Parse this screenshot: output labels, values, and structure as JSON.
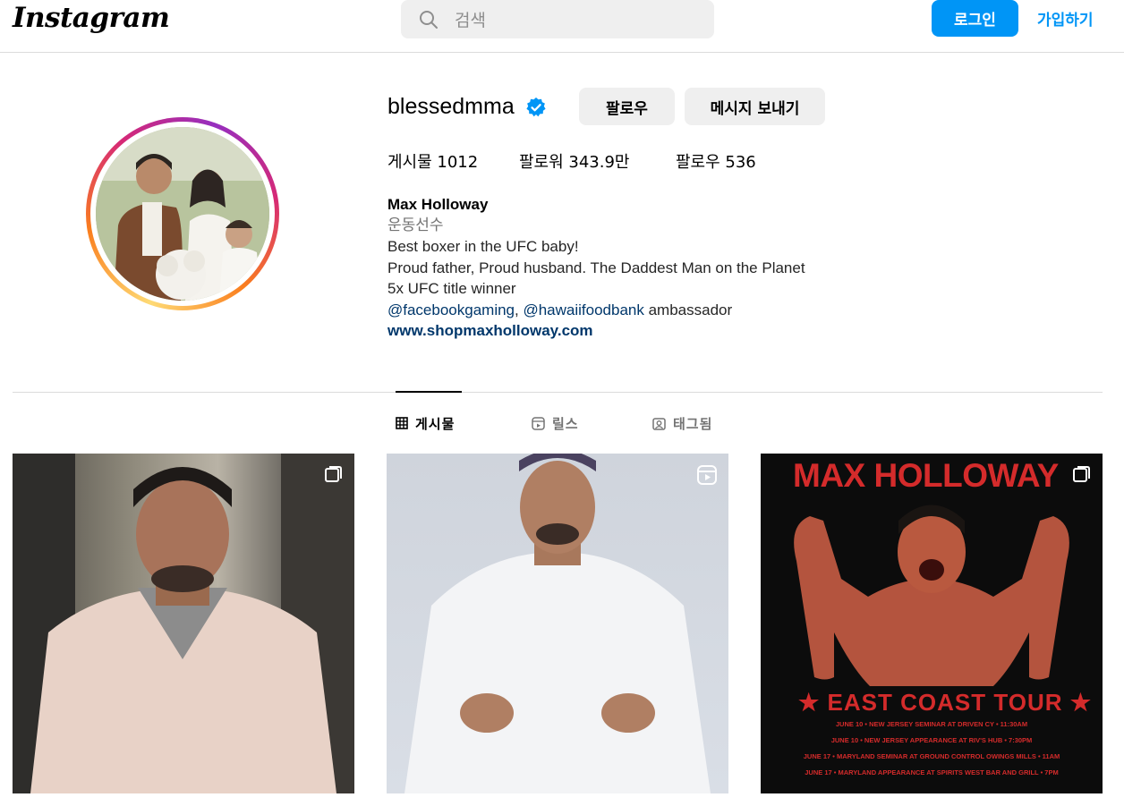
{
  "header": {
    "logo": "Instagram",
    "search_placeholder": "검색",
    "login_label": "로그인",
    "signup_label": "가입하기"
  },
  "profile": {
    "username": "blessedmma",
    "follow_label": "팔로우",
    "message_label": "메시지 보내기",
    "stats": {
      "posts": "게시물 1012",
      "followers": "팔로워 343.9만",
      "following": "팔로우 536"
    },
    "bio": {
      "name": "Max Holloway",
      "category": "운동선수",
      "line1": "Best boxer in the UFC baby!",
      "line2": "Proud father, Proud husband. The Daddest Man on the Planet",
      "line3": "5x UFC title winner",
      "mention1": "@facebookgaming",
      "separator": ", ",
      "mention2": "@hawaiifoodbank",
      "mention_suffix": " ambassador",
      "website": "www.shopmaxholloway.com"
    }
  },
  "tabs": [
    {
      "label": "게시물",
      "icon": "grid-icon"
    },
    {
      "label": "릴스",
      "icon": "reels-icon"
    },
    {
      "label": "태그됨",
      "icon": "tagged-icon"
    }
  ],
  "posts": [
    {
      "icon": "carousel-icon"
    },
    {
      "icon": "reels-icon"
    },
    {
      "icon": "carousel-icon",
      "title": "MAX HOLLOWAY",
      "tour": "★ EAST COAST TOUR ★",
      "lines": [
        "JUNE 10 • NEW JERSEY  SEMINAR AT DRIVEN CY • 11:30AM",
        "JUNE 10 • NEW JERSEY APPEARANCE AT RIV'S HUB • 7:30PM",
        "JUNE 17 • MARYLAND  SEMINAR AT GROUND CONTROL OWINGS MILLS • 11AM",
        "JUNE 17 • MARYLAND APPEARANCE AT SPIRITS WEST BAR AND GRILL • 7PM"
      ]
    }
  ],
  "colors": {
    "accent": "#0095f6",
    "link": "#00376b",
    "poster_red": "#d42b2b"
  }
}
